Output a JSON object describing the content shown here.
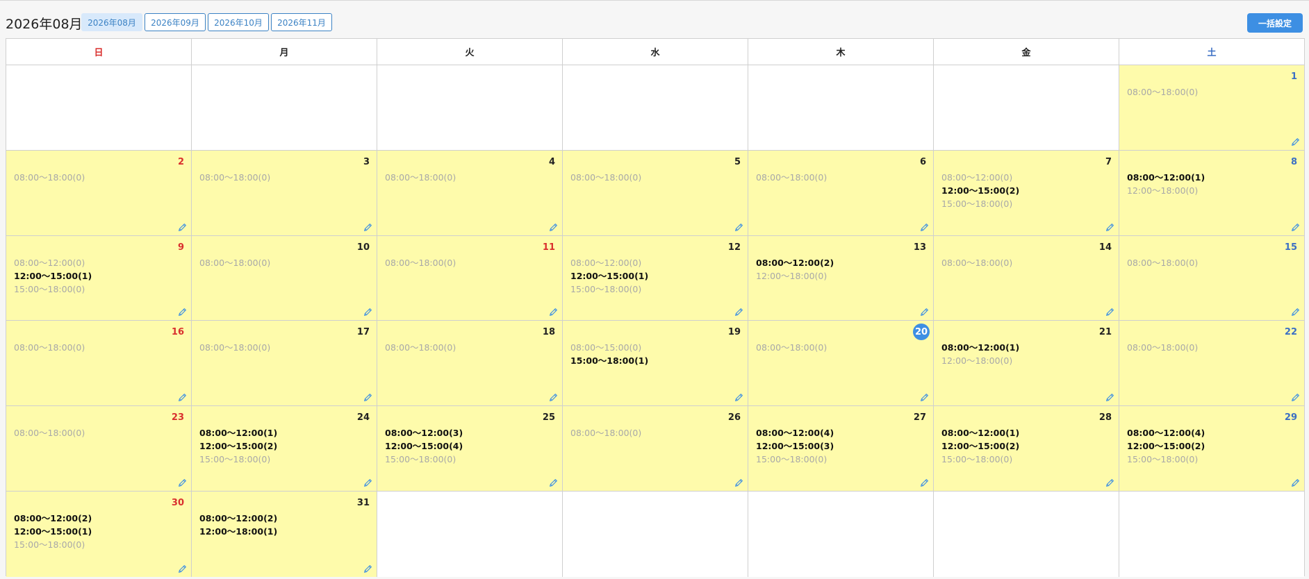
{
  "header": {
    "title": "2026年08月",
    "tabs": [
      {
        "label": "2026年08月",
        "active": true
      },
      {
        "label": "2026年09月",
        "active": false
      },
      {
        "label": "2026年10月",
        "active": false
      },
      {
        "label": "2026年11月",
        "active": false
      }
    ],
    "bulk_button": "一括設定"
  },
  "colors": {
    "accent": "#3d8fe3",
    "filled_cell": "#fefbab",
    "sunday": "#d9302e",
    "saturday": "#3b6fc4"
  },
  "weekdays": [
    "日",
    "月",
    "火",
    "水",
    "木",
    "金",
    "土"
  ],
  "weeks": [
    [
      null,
      null,
      null,
      null,
      null,
      null,
      {
        "day": "1",
        "slots": [
          {
            "text": "08:00〜18:00(0)",
            "booked": false
          }
        ]
      }
    ],
    [
      {
        "day": "2",
        "slots": [
          {
            "text": "08:00〜18:00(0)",
            "booked": false
          }
        ]
      },
      {
        "day": "3",
        "slots": [
          {
            "text": "08:00〜18:00(0)",
            "booked": false
          }
        ]
      },
      {
        "day": "4",
        "slots": [
          {
            "text": "08:00〜18:00(0)",
            "booked": false
          }
        ]
      },
      {
        "day": "5",
        "slots": [
          {
            "text": "08:00〜18:00(0)",
            "booked": false
          }
        ]
      },
      {
        "day": "6",
        "slots": [
          {
            "text": "08:00〜18:00(0)",
            "booked": false
          }
        ]
      },
      {
        "day": "7",
        "slots": [
          {
            "text": "08:00〜12:00(0)",
            "booked": false
          },
          {
            "text": "12:00〜15:00(2)",
            "booked": true
          },
          {
            "text": "15:00〜18:00(0)",
            "booked": false
          }
        ]
      },
      {
        "day": "8",
        "slots": [
          {
            "text": "08:00〜12:00(1)",
            "booked": true
          },
          {
            "text": "12:00〜18:00(0)",
            "booked": false
          }
        ]
      }
    ],
    [
      {
        "day": "9",
        "slots": [
          {
            "text": "08:00〜12:00(0)",
            "booked": false
          },
          {
            "text": "12:00〜15:00(1)",
            "booked": true
          },
          {
            "text": "15:00〜18:00(0)",
            "booked": false
          }
        ]
      },
      {
        "day": "10",
        "slots": [
          {
            "text": "08:00〜18:00(0)",
            "booked": false
          }
        ]
      },
      {
        "day": "11",
        "holiday": true,
        "slots": [
          {
            "text": "08:00〜18:00(0)",
            "booked": false
          }
        ]
      },
      {
        "day": "12",
        "slots": [
          {
            "text": "08:00〜12:00(0)",
            "booked": false
          },
          {
            "text": "12:00〜15:00(1)",
            "booked": true
          },
          {
            "text": "15:00〜18:00(0)",
            "booked": false
          }
        ]
      },
      {
        "day": "13",
        "slots": [
          {
            "text": "08:00〜12:00(2)",
            "booked": true
          },
          {
            "text": "12:00〜18:00(0)",
            "booked": false
          }
        ]
      },
      {
        "day": "14",
        "slots": [
          {
            "text": "08:00〜18:00(0)",
            "booked": false
          }
        ]
      },
      {
        "day": "15",
        "slots": [
          {
            "text": "08:00〜18:00(0)",
            "booked": false
          }
        ]
      }
    ],
    [
      {
        "day": "16",
        "slots": [
          {
            "text": "08:00〜18:00(0)",
            "booked": false
          }
        ]
      },
      {
        "day": "17",
        "slots": [
          {
            "text": "08:00〜18:00(0)",
            "booked": false
          }
        ]
      },
      {
        "day": "18",
        "slots": [
          {
            "text": "08:00〜18:00(0)",
            "booked": false
          }
        ]
      },
      {
        "day": "19",
        "slots": [
          {
            "text": "08:00〜15:00(0)",
            "booked": false
          },
          {
            "text": "15:00〜18:00(1)",
            "booked": true
          }
        ]
      },
      {
        "day": "20",
        "today": true,
        "slots": [
          {
            "text": "08:00〜18:00(0)",
            "booked": false
          }
        ]
      },
      {
        "day": "21",
        "slots": [
          {
            "text": "08:00〜12:00(1)",
            "booked": true
          },
          {
            "text": "12:00〜18:00(0)",
            "booked": false
          }
        ]
      },
      {
        "day": "22",
        "slots": [
          {
            "text": "08:00〜18:00(0)",
            "booked": false
          }
        ]
      }
    ],
    [
      {
        "day": "23",
        "slots": [
          {
            "text": "08:00〜18:00(0)",
            "booked": false
          }
        ]
      },
      {
        "day": "24",
        "slots": [
          {
            "text": "08:00〜12:00(1)",
            "booked": true
          },
          {
            "text": "12:00〜15:00(2)",
            "booked": true
          },
          {
            "text": "15:00〜18:00(0)",
            "booked": false
          }
        ]
      },
      {
        "day": "25",
        "slots": [
          {
            "text": "08:00〜12:00(3)",
            "booked": true
          },
          {
            "text": "12:00〜15:00(4)",
            "booked": true
          },
          {
            "text": "15:00〜18:00(0)",
            "booked": false
          }
        ]
      },
      {
        "day": "26",
        "slots": [
          {
            "text": "08:00〜18:00(0)",
            "booked": false
          }
        ]
      },
      {
        "day": "27",
        "slots": [
          {
            "text": "08:00〜12:00(4)",
            "booked": true
          },
          {
            "text": "12:00〜15:00(3)",
            "booked": true
          },
          {
            "text": "15:00〜18:00(0)",
            "booked": false
          }
        ]
      },
      {
        "day": "28",
        "slots": [
          {
            "text": "08:00〜12:00(1)",
            "booked": true
          },
          {
            "text": "12:00〜15:00(2)",
            "booked": true
          },
          {
            "text": "15:00〜18:00(0)",
            "booked": false
          }
        ]
      },
      {
        "day": "29",
        "slots": [
          {
            "text": "08:00〜12:00(4)",
            "booked": true
          },
          {
            "text": "12:00〜15:00(2)",
            "booked": true
          },
          {
            "text": "15:00〜18:00(0)",
            "booked": false
          }
        ]
      }
    ],
    [
      {
        "day": "30",
        "slots": [
          {
            "text": "08:00〜12:00(2)",
            "booked": true
          },
          {
            "text": "12:00〜15:00(1)",
            "booked": true
          },
          {
            "text": "15:00〜18:00(0)",
            "booked": false
          }
        ]
      },
      {
        "day": "31",
        "slots": [
          {
            "text": "08:00〜12:00(2)",
            "booked": true
          },
          {
            "text": "12:00〜18:00(1)",
            "booked": true
          }
        ]
      },
      null,
      null,
      null,
      null,
      null
    ]
  ]
}
